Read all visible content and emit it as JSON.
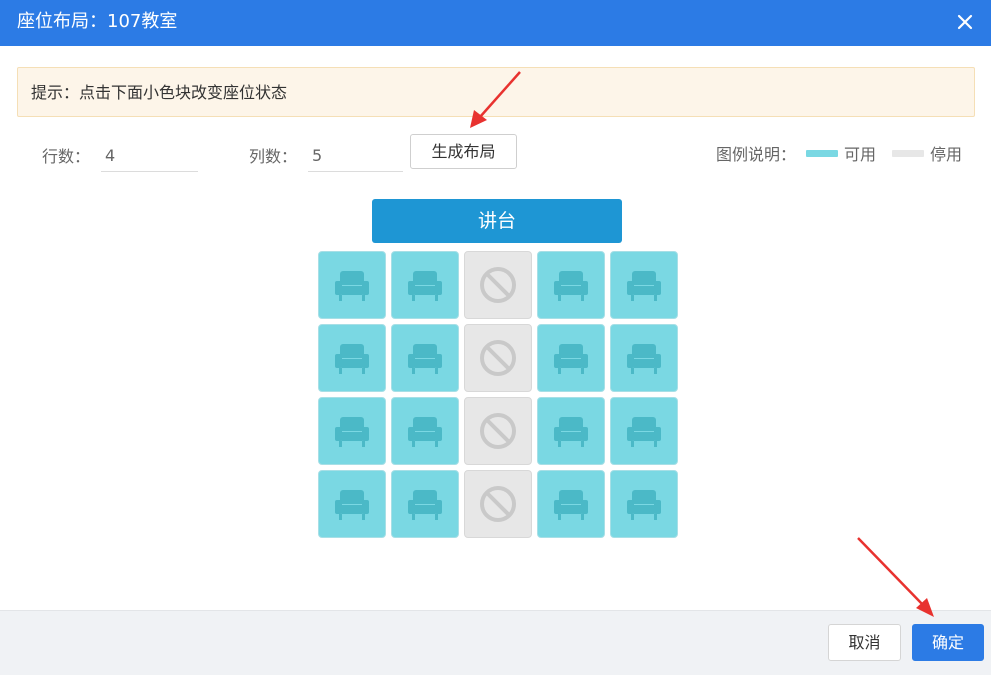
{
  "header": {
    "title": "座位布局：107教室"
  },
  "tip": {
    "text": "提示：点击下面小色块改变座位状态"
  },
  "form": {
    "rows_label": "行数：",
    "rows_value": "4",
    "cols_label": "列数：",
    "cols_value": "5",
    "generate_label": "生成布局"
  },
  "legend": {
    "label": "图例说明：",
    "available_label": "可用",
    "disabled_label": "停用",
    "available_color": "#7ad8e3",
    "disabled_color": "#e7e7e7"
  },
  "podium": {
    "label": "讲台"
  },
  "seats": {
    "icons": {
      "available": "armchair-icon",
      "disabled": "prohibited-icon"
    },
    "rows": [
      [
        "available",
        "available",
        "disabled",
        "available",
        "available"
      ],
      [
        "available",
        "available",
        "disabled",
        "available",
        "available"
      ],
      [
        "available",
        "available",
        "disabled",
        "available",
        "available"
      ],
      [
        "available",
        "available",
        "disabled",
        "available",
        "available"
      ]
    ]
  },
  "footer": {
    "cancel_label": "取消",
    "confirm_label": "确定"
  },
  "colors": {
    "primary": "#2c7be5",
    "podium": "#1e96d4",
    "arrow": "#e8322f"
  }
}
